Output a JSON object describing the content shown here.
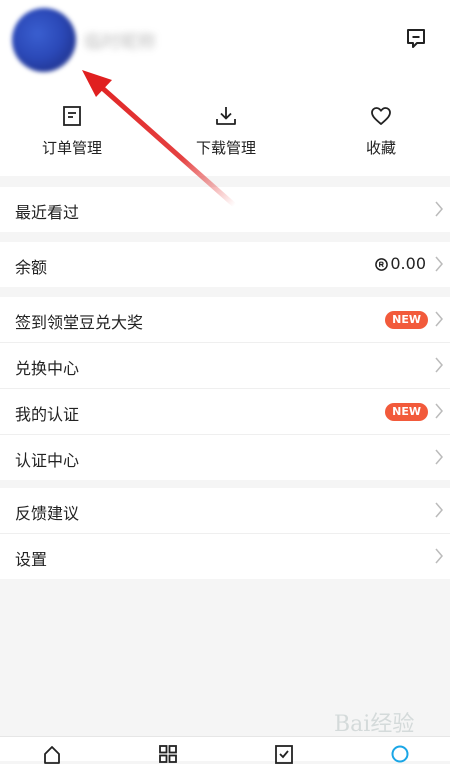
{
  "header": {
    "username": "临时昵称"
  },
  "actions": [
    {
      "label": "订单管理",
      "icon": "order-icon"
    },
    {
      "label": "下载管理",
      "icon": "download-icon"
    },
    {
      "label": "收藏",
      "icon": "heart-icon"
    }
  ],
  "menu": {
    "recent": "最近看过",
    "balance": {
      "label": "余额",
      "value": "0.00"
    },
    "checkin": {
      "label": "签到领堂豆兑大奖",
      "badge": "NEW"
    },
    "exchange": "兑换中心",
    "my_cert": {
      "label": "我的认证",
      "badge": "NEW"
    },
    "cert_center": "认证中心",
    "feedback": "反馈建议",
    "settings": "设置"
  },
  "watermark": {
    "text": "Bai经验"
  },
  "colors": {
    "badge": "#f25a3b",
    "accent": "#1aa6e6",
    "annotation_arrow": "#e02020"
  }
}
